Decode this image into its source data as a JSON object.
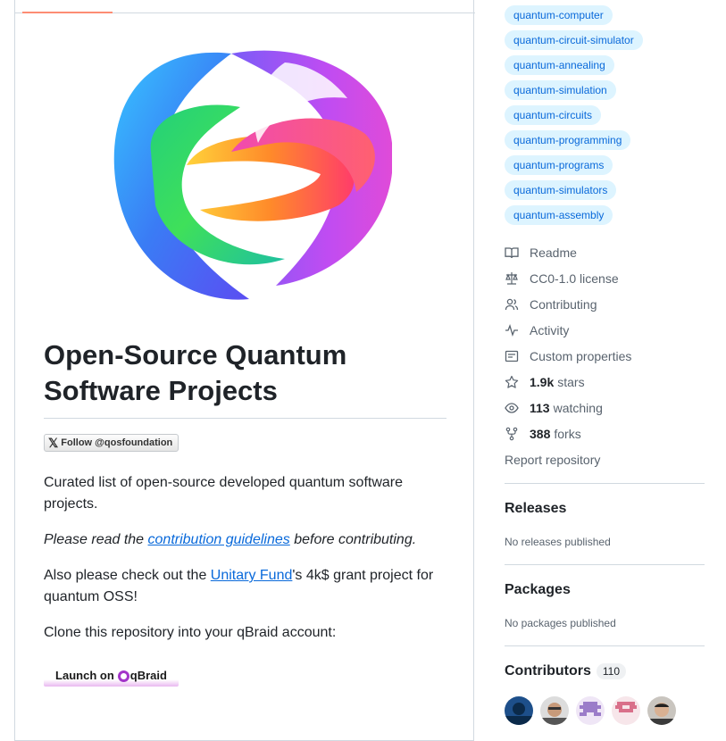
{
  "readme": {
    "title": "Open-Source Quantum Software Projects",
    "follow_badge": "Follow @qosfoundation",
    "intro": "Curated list of open-source developed quantum software projects.",
    "read_prefix": "Please read the ",
    "read_link": "contribution guidelines",
    "read_suffix": " before contributing.",
    "also_prefix": "Also please check out the ",
    "also_link": "Unitary Fund",
    "also_suffix": "'s 4k$ grant project for quantum OSS!",
    "clone_text": "Clone this repository into your qBraid account:",
    "launch_prefix": "Launch on",
    "launch_brand": "qBraid"
  },
  "topics": [
    "quantum-computer",
    "quantum-circuit-simulator",
    "quantum-annealing",
    "quantum-simulation",
    "quantum-circuits",
    "quantum-programming",
    "quantum-programs",
    "quantum-simulators",
    "quantum-assembly"
  ],
  "about": {
    "readme": "Readme",
    "license": "CC0-1.0 license",
    "contributing": "Contributing",
    "activity": "Activity",
    "custom_properties": "Custom properties",
    "stars_count": "1.9k",
    "stars_label": "stars",
    "watching_count": "113",
    "watching_label": "watching",
    "forks_count": "388",
    "forks_label": "forks",
    "report": "Report repository"
  },
  "releases": {
    "heading": "Releases",
    "empty": "No releases published"
  },
  "packages": {
    "heading": "Packages",
    "empty": "No packages published"
  },
  "contributors": {
    "heading": "Contributors",
    "count": "110"
  },
  "colors": {
    "accent": "#0969da",
    "topic_bg": "#ddf4ff",
    "tab_underline": "#fd8c73"
  }
}
